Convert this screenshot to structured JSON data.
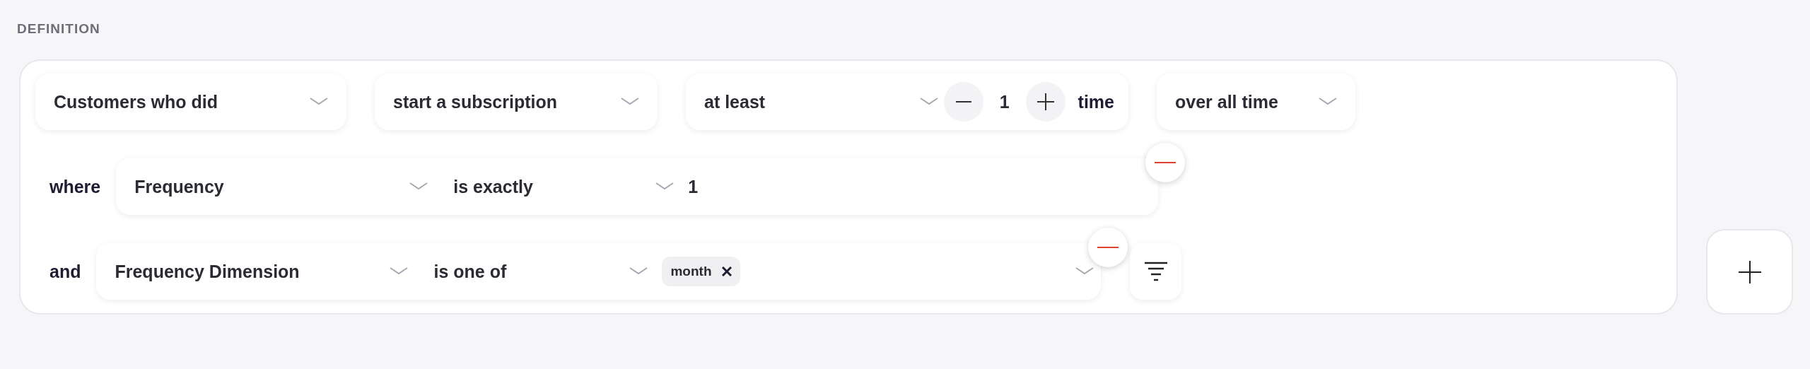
{
  "section_title": "DEFINITION",
  "event_row": [
    {
      "kind": "select",
      "value": "Customers who did"
    },
    {
      "kind": "select",
      "value": "start a subscription"
    },
    {
      "kind": "counter",
      "value": "at least",
      "count": "1",
      "unit": "time"
    },
    {
      "kind": "select",
      "value": "over all time"
    }
  ],
  "conditions": [
    {
      "connector": "where",
      "property": "Frequency",
      "operator": "is exactly",
      "kind": "text",
      "value": "1"
    },
    {
      "connector": "and",
      "property": "Frequency Dimension",
      "operator": "is one of",
      "kind": "tags",
      "tags": [
        "month"
      ]
    }
  ]
}
